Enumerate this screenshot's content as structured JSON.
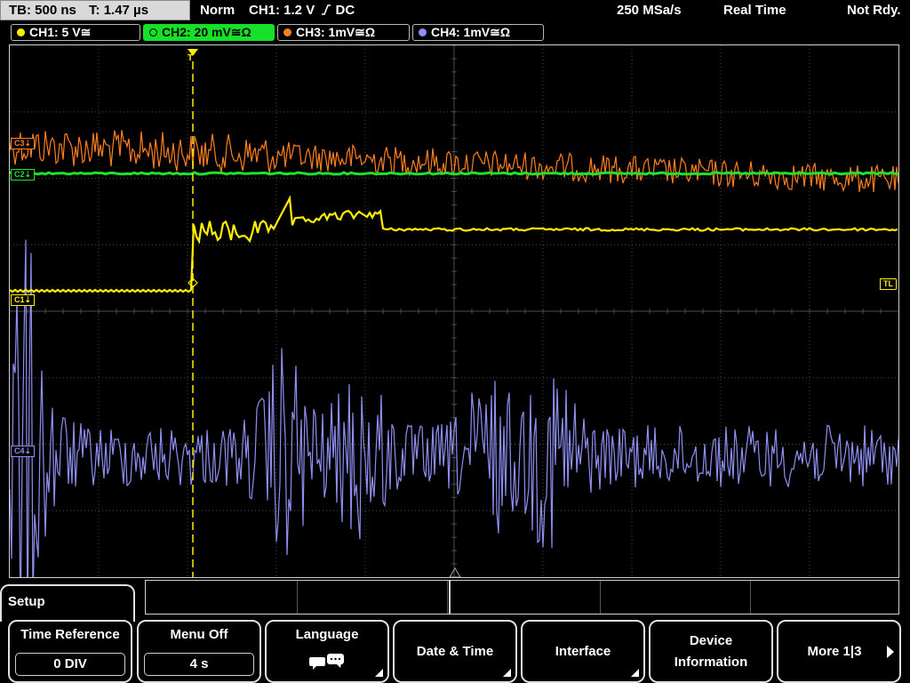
{
  "status_bar": {
    "timebase": "TB: 500 ns",
    "trigger_time": "T: 1.47 µs",
    "trigger_mode": "Norm",
    "trigger_source": "CH1: 1.2 V",
    "trigger_coupling": "DC",
    "sample_rate": "250 MSa/s",
    "acquisition": "Real Time",
    "state": "Not Rdy."
  },
  "channels": [
    {
      "id": "ch1",
      "label": "CH1: 5 V≅",
      "color": "#ffee00",
      "active": false
    },
    {
      "id": "ch2",
      "label": "CH2: 20 mV≅Ω",
      "color": "#1ee32a",
      "active": true
    },
    {
      "id": "ch3",
      "label": "CH3: 1mV≅Ω",
      "color": "#ff7f1e",
      "active": false
    },
    {
      "id": "ch4",
      "label": "CH4: 1mV≅Ω",
      "color": "#8f8ff2",
      "active": false
    }
  ],
  "waveform_markers": {
    "ch1": "C1⇣",
    "ch2": "C2⇣",
    "ch3": "C3⇣",
    "ch4": "C4⇣",
    "trigger_level": "TL",
    "trigger_position": "T"
  },
  "menu": {
    "title": "Setup",
    "softkeys": [
      {
        "id": "time-reference",
        "label": "Time Reference",
        "value": "0 DIV"
      },
      {
        "id": "menu-off",
        "label": "Menu Off",
        "value": "4 s"
      },
      {
        "id": "language",
        "label": "Language",
        "icon": "speech-bubble-icon"
      },
      {
        "id": "date-time",
        "label": "Date & Time"
      },
      {
        "id": "interface",
        "label": "Interface"
      },
      {
        "id": "device-information",
        "label_line1": "Device",
        "label_line2": "Information"
      },
      {
        "id": "more",
        "label": "More 1|3"
      }
    ]
  },
  "colors": {
    "ch1": "#ffee00",
    "ch2": "#1ee32a",
    "ch3": "#ff7f1e",
    "ch4": "#8f8ff2",
    "grid": "#5a5a5a"
  }
}
